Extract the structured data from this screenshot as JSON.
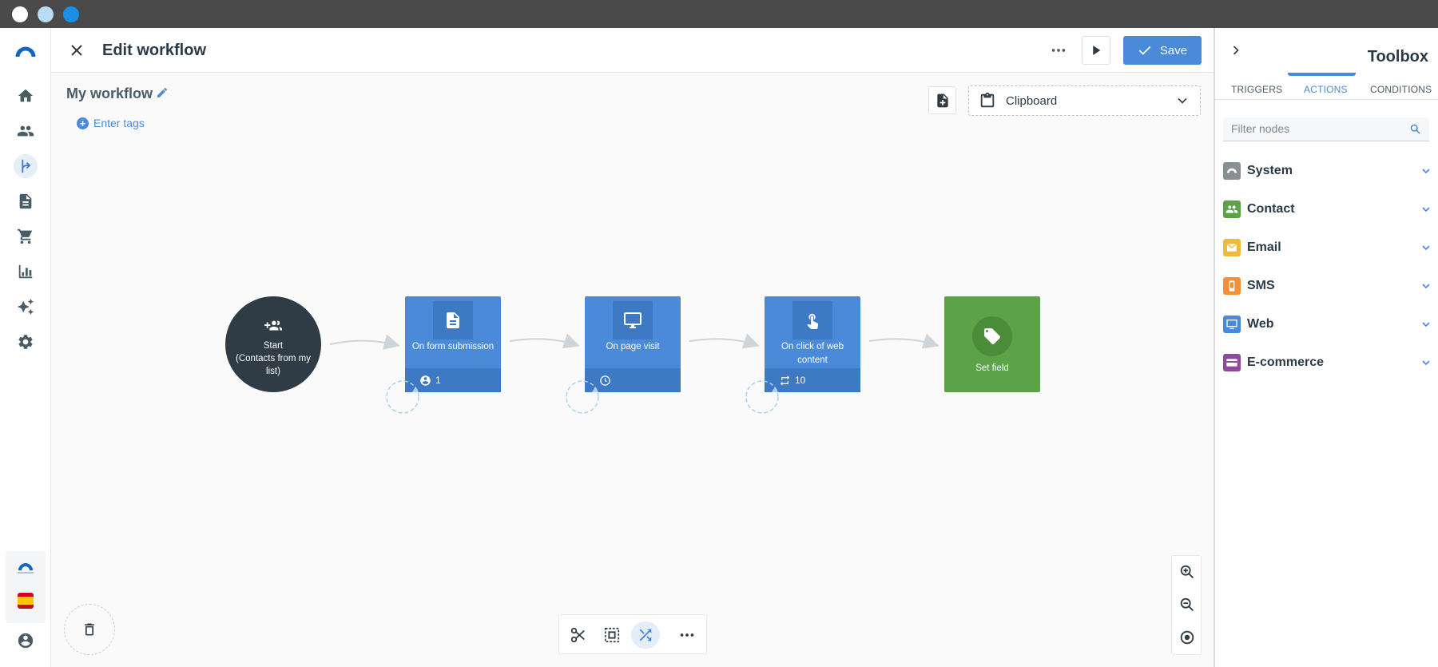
{
  "header": {
    "title": "Edit workflow",
    "save_label": "Save"
  },
  "workflow": {
    "name": "My workflow",
    "tags_label": "Enter tags"
  },
  "clipboard": {
    "label": "Clipboard"
  },
  "toolbox": {
    "title": "Toolbox",
    "tabs": [
      "TRIGGERS",
      "ACTIONS",
      "CONDITIONS"
    ],
    "active_tab": "ACTIONS",
    "filter_placeholder": "Filter nodes",
    "categories": [
      {
        "label": "System",
        "color": "#8a8f94"
      },
      {
        "label": "Contact",
        "color": "#5ba346"
      },
      {
        "label": "Email",
        "color": "#f2b940"
      },
      {
        "label": "SMS",
        "color": "#f2903a"
      },
      {
        "label": "Web",
        "color": "#4a8ad9"
      },
      {
        "label": "E-commerce",
        "color": "#8e4a9c"
      }
    ]
  },
  "nodes": {
    "start": {
      "line1": "Start",
      "line2": "(Contacts from my list)"
    },
    "form": {
      "title": "On form submission",
      "badge": "1"
    },
    "page": {
      "title": "On page visit"
    },
    "click": {
      "title": "On click of web content",
      "badge": "10"
    },
    "setfield": {
      "title": "Set field"
    }
  },
  "colors": {
    "accent": "#4a8ad9",
    "trigger_node": "#4a8ad9",
    "action_node": "#5ba346",
    "start_node": "#2f3b45"
  },
  "chrome": {
    "dots": [
      "#ffffff",
      "#b9dcf5",
      "#1a90e8"
    ]
  }
}
